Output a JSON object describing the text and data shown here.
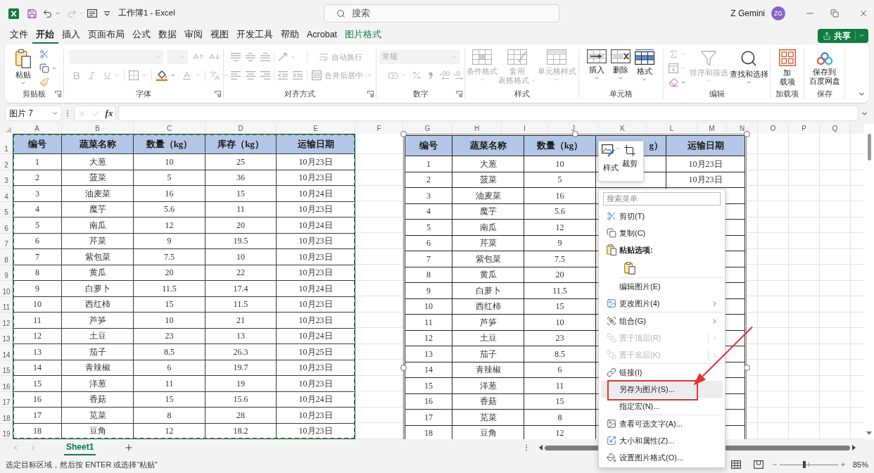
{
  "title_bar": {
    "title": "工作簿1 - Excel",
    "search": {
      "placeholder": "搜索"
    },
    "user": {
      "name": "Z Gemini",
      "initials": "ZG"
    }
  },
  "menu_tabs": [
    {
      "label": "文件",
      "selected": false,
      "contextual": false
    },
    {
      "label": "开始",
      "selected": true,
      "contextual": false
    },
    {
      "label": "插入",
      "selected": false,
      "contextual": false
    },
    {
      "label": "页面布局",
      "selected": false,
      "contextual": false
    },
    {
      "label": "公式",
      "selected": false,
      "contextual": false
    },
    {
      "label": "数据",
      "selected": false,
      "contextual": false
    },
    {
      "label": "审阅",
      "selected": false,
      "contextual": false
    },
    {
      "label": "视图",
      "selected": false,
      "contextual": false
    },
    {
      "label": "开发工具",
      "selected": false,
      "contextual": false
    },
    {
      "label": "帮助",
      "selected": false,
      "contextual": false
    },
    {
      "label": "Acrobat",
      "selected": false,
      "contextual": false
    },
    {
      "label": "图片格式",
      "selected": false,
      "contextual": true
    }
  ],
  "share_button": {
    "label": "共享"
  },
  "ribbon": {
    "groups": [
      {
        "kind": "clipboard",
        "label": "剪贴板",
        "launcher": true,
        "disabled": false,
        "buttons": [
          {
            "lines": [
              "粘贴"
            ],
            "disabled": false
          }
        ]
      },
      {
        "kind": "font",
        "label": "字体",
        "launcher": true,
        "disabled": true
      },
      {
        "kind": "alignment",
        "label": "对齐方式",
        "launcher": true,
        "disabled": true,
        "buttons": [
          {
            "label": "自动换行",
            "disabled": true
          },
          {
            "label": "合并后居中",
            "disabled": true
          }
        ]
      },
      {
        "kind": "number",
        "label": "数字",
        "launcher": true,
        "disabled": true,
        "format": "常规"
      },
      {
        "kind": "styles",
        "label": "样式",
        "disabled": true,
        "buttons": [
          {
            "lines": [
              "条件格式"
            ],
            "disabled": true
          },
          {
            "lines": [
              "套用",
              "表格格式"
            ],
            "disabled": true
          },
          {
            "lines": [
              "单元格样式"
            ],
            "disabled": true
          }
        ]
      },
      {
        "kind": "cells",
        "label": "单元格",
        "buttons": [
          {
            "lines": [
              "插入"
            ],
            "disabled": false
          },
          {
            "lines": [
              "删除"
            ],
            "disabled": false
          },
          {
            "lines": [
              "格式"
            ],
            "disabled": false
          }
        ]
      },
      {
        "kind": "editing",
        "label": "编辑",
        "tools": [
          {
            "disabled": true
          },
          {
            "disabled": true
          },
          {
            "disabled": false
          }
        ],
        "buttons": [
          {
            "lines": [
              "排序和筛选"
            ],
            "disabled": true
          },
          {
            "lines": [
              "查找和选择"
            ],
            "disabled": false
          }
        ]
      },
      {
        "kind": "addins",
        "label": "加载项",
        "buttons": [
          {
            "lines": [
              "加",
              "载项"
            ],
            "disabled": false
          }
        ]
      },
      {
        "kind": "save",
        "label": "保存",
        "buttons": [
          {
            "lines": [
              "保存到",
              "百度网盘"
            ],
            "disabled": false
          }
        ]
      }
    ]
  },
  "formula_bar": {
    "name_box": "图片 7",
    "function_button": "fx"
  },
  "sheet": {
    "column_letters": [
      "A",
      "B",
      "C",
      "D",
      "E",
      "F",
      "G",
      "H",
      "I",
      "J",
      "K",
      "L",
      "M",
      "N",
      "O",
      "P",
      "Q"
    ],
    "row_numbers": [
      "1",
      "2",
      "3",
      "4",
      "5",
      "6",
      "7",
      "8",
      "9",
      "10",
      "11",
      "12",
      "13",
      "14",
      "15",
      "16",
      "17",
      "18",
      "19"
    ],
    "table": {
      "copied": true,
      "header": [
        "编号",
        "蔬菜名称",
        "数量（kg）",
        "库存（kg）",
        "运输日期"
      ],
      "rows": [
        [
          "1",
          "大葱",
          "10",
          "25",
          "10月23日"
        ],
        [
          "2",
          "菠菜",
          "5",
          "36",
          "10月23日"
        ],
        [
          "3",
          "油麦菜",
          "16",
          "15",
          "10月24日"
        ],
        [
          "4",
          "魔芋",
          "5.6",
          "11",
          "10月23日"
        ],
        [
          "5",
          "南瓜",
          "12",
          "20",
          "10月24日"
        ],
        [
          "6",
          "芹菜",
          "9",
          "19.5",
          "10月23日"
        ],
        [
          "7",
          "紫包菜",
          "7.5",
          "10",
          "10月23日"
        ],
        [
          "8",
          "黄瓜",
          "20",
          "22",
          "10月23日"
        ],
        [
          "9",
          "白萝卜",
          "11.5",
          "17.4",
          "10月24日"
        ],
        [
          "10",
          "西红柿",
          "15",
          "11.5",
          "10月23日"
        ],
        [
          "11",
          "芦笋",
          "10",
          "21",
          "10月23日"
        ],
        [
          "12",
          "土豆",
          "23",
          "13",
          "10月24日"
        ],
        [
          "13",
          "茄子",
          "8.5",
          "26.3",
          "10月25日"
        ],
        [
          "14",
          "青辣椒",
          "6",
          "19.7",
          "10月23日"
        ],
        [
          "15",
          "洋葱",
          "11",
          "19",
          "10月23日"
        ],
        [
          "16",
          "香菇",
          "15",
          "15.6",
          "10月24日"
        ],
        [
          "17",
          "苋菜",
          "8",
          "28",
          "10月23日"
        ],
        [
          "18",
          "豆角",
          "12",
          "18.2",
          "10月23日"
        ]
      ]
    }
  },
  "picture": {
    "selected": true,
    "header": {
      "number": "编号",
      "name": "蔬菜名称",
      "quantity": "数量（kg）",
      "stock": "g）",
      "date": "运输日期"
    },
    "rows": [
      {
        "number": "1",
        "name": "大葱",
        "quantity": "10",
        "date": "10月23日"
      },
      {
        "number": "2",
        "name": "菠菜",
        "quantity": "5",
        "date": "10月23日"
      },
      {
        "number": "3",
        "name": "油麦菜",
        "quantity": "16"
      },
      {
        "number": "4",
        "name": "魔芋",
        "quantity": "5.6"
      },
      {
        "number": "5",
        "name": "南瓜",
        "quantity": "12"
      },
      {
        "number": "6",
        "name": "芹菜",
        "quantity": "9"
      },
      {
        "number": "7",
        "name": "紫包菜",
        "quantity": "7.5"
      },
      {
        "number": "8",
        "name": "黄瓜",
        "quantity": "20"
      },
      {
        "number": "9",
        "name": "白萝卜",
        "quantity": "11.5"
      },
      {
        "number": "10",
        "name": "西红柿",
        "quantity": "15"
      },
      {
        "number": "11",
        "name": "芦笋",
        "quantity": "10"
      },
      {
        "number": "12",
        "name": "土豆",
        "quantity": "23"
      },
      {
        "number": "13",
        "name": "茄子",
        "quantity": "8.5"
      },
      {
        "number": "14",
        "name": "青辣椒",
        "quantity": "6"
      },
      {
        "number": "15",
        "name": "洋葱",
        "quantity": "11"
      },
      {
        "number": "16",
        "name": "香菇",
        "quantity": "15"
      },
      {
        "number": "17",
        "name": "苋菜",
        "quantity": "8"
      },
      {
        "number": "18",
        "name": "豆角",
        "quantity": "12"
      }
    ]
  },
  "mini_toolbar": {
    "buttons": [
      {
        "label": "样式"
      },
      {
        "label": "裁剪"
      }
    ]
  },
  "context_menu": {
    "search": {
      "placeholder": "搜索菜单"
    },
    "groups": [
      [
        {
          "kind": "command",
          "label": "剪切(T)",
          "disabled": false,
          "selected": false,
          "submenu": false,
          "split": false
        },
        {
          "kind": "command",
          "label": "复制(C)",
          "disabled": false,
          "selected": false,
          "submenu": false,
          "split": false
        },
        {
          "kind": "heading",
          "label": "粘贴选项:"
        },
        {
          "kind": "paste-options"
        }
      ],
      [
        {
          "kind": "command",
          "label": "编辑图片(E)",
          "disabled": false,
          "selected": false,
          "submenu": false,
          "split": false
        },
        {
          "kind": "command",
          "label": "更改图片(4)",
          "disabled": false,
          "selected": false,
          "submenu": true,
          "split": false
        }
      ],
      [
        {
          "kind": "command",
          "label": "组合(G)",
          "disabled": false,
          "selected": false,
          "submenu": true,
          "split": false
        },
        {
          "kind": "command",
          "label": "置于顶层(R)",
          "disabled": true,
          "selected": false,
          "submenu": true,
          "split": true
        },
        {
          "kind": "command",
          "label": "置于底层(K)",
          "disabled": true,
          "selected": false,
          "submenu": true,
          "split": true
        }
      ],
      [
        {
          "kind": "command",
          "label": "链接(I)",
          "disabled": false,
          "selected": false,
          "submenu": false,
          "split": false
        },
        {
          "kind": "command",
          "label": "另存为图片(S)...",
          "disabled": false,
          "selected": true,
          "submenu": false,
          "split": false
        },
        {
          "kind": "command",
          "label": "指定宏(N)...",
          "disabled": false,
          "selected": false,
          "submenu": false,
          "split": false
        }
      ],
      [
        {
          "kind": "command",
          "label": "查看可选文字(A)...",
          "disabled": false,
          "selected": false,
          "submenu": false,
          "split": false
        },
        {
          "kind": "command",
          "label": "大小和属性(Z)...",
          "disabled": false,
          "selected": false,
          "submenu": false,
          "split": false
        },
        {
          "kind": "command",
          "label": "设置图片格式(O)...",
          "disabled": false,
          "selected": false,
          "submenu": false,
          "split": false
        }
      ]
    ]
  },
  "sheet_tabs": [
    {
      "label": "Sheet1",
      "selected": true
    }
  ],
  "status_bar": {
    "message": "选定目标区域，然后按 ENTER 或选择“粘贴”",
    "zoom": {
      "level": 0.42,
      "reading": "85%"
    }
  }
}
